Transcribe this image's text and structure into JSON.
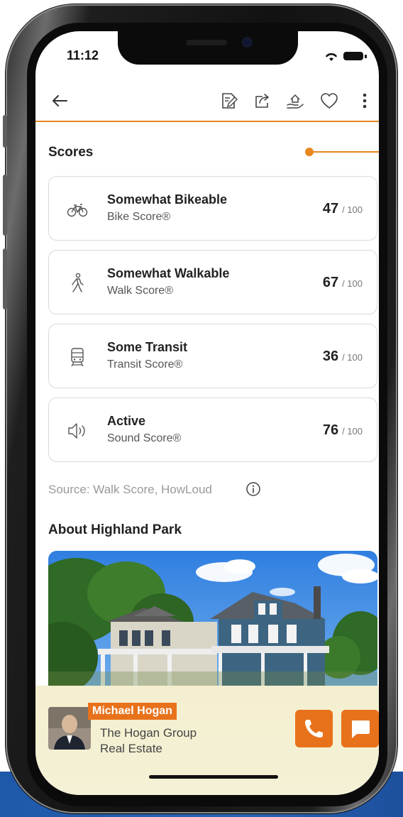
{
  "status_bar": {
    "time": "11:12"
  },
  "toolbar": {
    "back_icon": "arrow-left-icon",
    "actions": [
      "edit-note-icon",
      "share-icon",
      "home-hand-icon",
      "heart-icon",
      "more-vert-icon"
    ]
  },
  "scores": {
    "title": "Scores",
    "items": [
      {
        "icon": "bike-icon",
        "title": "Somewhat Bikeable",
        "subtitle": "Bike Score®",
        "value": "47",
        "max": "/ 100"
      },
      {
        "icon": "walk-icon",
        "title": "Somewhat Walkable",
        "subtitle": "Walk Score®",
        "value": "67",
        "max": "/ 100"
      },
      {
        "icon": "train-icon",
        "title": "Some Transit",
        "subtitle": "Transit Score®",
        "value": "36",
        "max": "/ 100"
      },
      {
        "icon": "speaker-icon",
        "title": "Active",
        "subtitle": "Sound Score®",
        "value": "76",
        "max": "/ 100"
      }
    ],
    "source": "Source: Walk Score, HowLoud"
  },
  "about": {
    "title": "About Highland Park"
  },
  "agent": {
    "name": "Michael Hogan",
    "company_line1": "The Hogan Group",
    "company_line2": "Real Estate"
  },
  "colors": {
    "accent": "#e8721c",
    "divider": "#e8861f"
  }
}
